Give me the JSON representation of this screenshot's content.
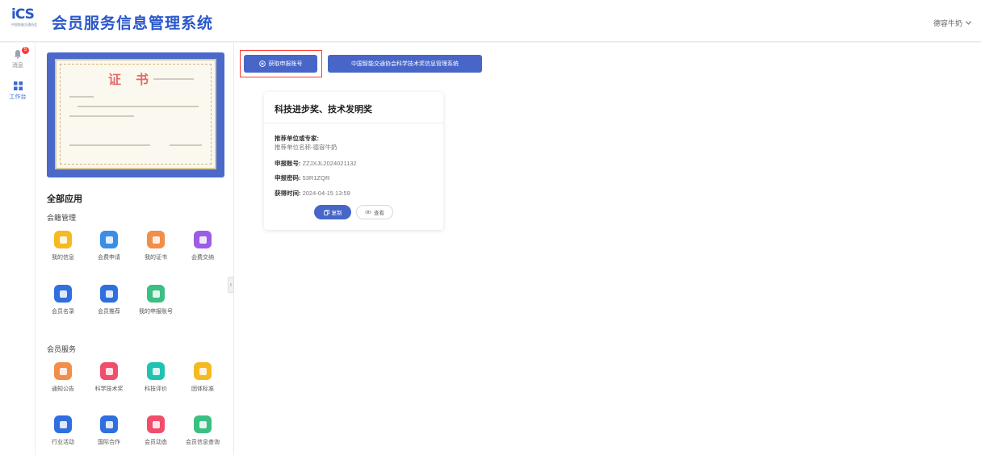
{
  "header": {
    "logo_text": "iCS",
    "logo_sub": "中国智能交通协会",
    "title": "会员服务信息管理系统",
    "user_name": "德容牛奶"
  },
  "rail": {
    "items": [
      {
        "label": "消息",
        "badge": "5",
        "icon": "bell-icon"
      },
      {
        "label": "工作台",
        "icon": "grid-icon"
      }
    ]
  },
  "certificate": {
    "title": "证书"
  },
  "apps": {
    "section_title": "全部应用",
    "groups": [
      {
        "title": "会籍管理",
        "items": [
          {
            "label": "我的信息",
            "color": "#f5b921",
            "icon": "info-icon"
          },
          {
            "label": "会费申请",
            "color": "#3a8ee6",
            "icon": "document-icon"
          },
          {
            "label": "我的证书",
            "color": "#f08e4a",
            "icon": "certificate-icon"
          },
          {
            "label": "会费交纳",
            "color": "#9b5de5",
            "icon": "payment-icon"
          },
          {
            "label": "会员名录",
            "color": "#2f6fde",
            "icon": "directory-icon"
          },
          {
            "label": "会员推荐",
            "color": "#2f6fde",
            "icon": "recommend-icon"
          },
          {
            "label": "我的申报账号",
            "color": "#3bbf83",
            "icon": "account-icon"
          }
        ]
      },
      {
        "title": "会员服务",
        "items": [
          {
            "label": "通知公告",
            "color": "#f08e4a",
            "icon": "notice-icon"
          },
          {
            "label": "科学技术奖",
            "color": "#f04e6b",
            "icon": "award-icon"
          },
          {
            "label": "科技评价",
            "color": "#21c2b0",
            "icon": "evaluate-icon"
          },
          {
            "label": "团体标准",
            "color": "#f5b921",
            "icon": "standard-icon"
          },
          {
            "label": "行业活动",
            "color": "#2f6fde",
            "icon": "activity-icon"
          },
          {
            "label": "国际合作",
            "color": "#2f6fde",
            "icon": "cooperation-icon"
          },
          {
            "label": "会员动态",
            "color": "#f04e6b",
            "icon": "news-icon"
          },
          {
            "label": "会员信息查询",
            "color": "#3bbf83",
            "icon": "query-icon"
          }
        ]
      }
    ]
  },
  "toolbar": {
    "get_account_label": "获取申报账号",
    "system_link_label": "中国智能交通协会科学技术奖信息管理系统"
  },
  "card": {
    "title": "科技进步奖、技术发明奖",
    "unit_label": "推荐单位或专家:",
    "unit_value": "推荐单位名称-德容牛奶",
    "account_label": "申报账号:",
    "account_value": "ZZJXJL2024021132",
    "password_label": "申报密码:",
    "password_value": "53R1ZQR",
    "time_label": "获得时间:",
    "time_value": "2024-04-15 13:59",
    "copy_label": "复制",
    "view_label": "查看"
  }
}
